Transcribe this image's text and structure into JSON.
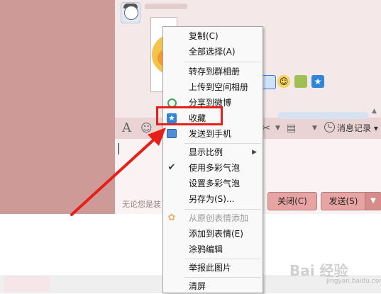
{
  "menu": {
    "items": [
      {
        "label": "复制(C)",
        "enabled": true
      },
      {
        "label": "全部选择(A)",
        "enabled": true
      },
      {
        "label": "转存到群相册",
        "enabled": true
      },
      {
        "label": "上传到空间相册",
        "enabled": true
      },
      {
        "label": "分享到微博",
        "enabled": true,
        "icon": "weibo-icon"
      },
      {
        "label": "收藏",
        "enabled": true,
        "icon": "star-icon",
        "highlighted": true
      },
      {
        "label": "发送到手机",
        "enabled": true,
        "icon": "phone-icon"
      },
      {
        "label": "显示比例",
        "enabled": true,
        "submenu": true
      },
      {
        "label": "使用多彩气泡",
        "enabled": true,
        "checked": true
      },
      {
        "label": "设置多彩气泡",
        "enabled": true
      },
      {
        "label": "另存为(S)...",
        "enabled": true
      },
      {
        "label": "从原创表情添加",
        "enabled": false,
        "icon": "add-emoji-icon"
      },
      {
        "label": "添加到表情(E)",
        "enabled": true
      },
      {
        "label": "涂鸦编辑",
        "enabled": true
      },
      {
        "label": "举报此图片",
        "enabled": true
      },
      {
        "label": "清屏",
        "enabled": true
      }
    ]
  },
  "chat": {
    "input_hint": "无论您是装",
    "history_label": "消息记录",
    "close_label": "关闭(C)",
    "send_label": "发送(S)"
  },
  "colors": {
    "highlight": "#e62018",
    "left_panel": "#cd9a98",
    "button": "#e8a4a2"
  },
  "watermark": {
    "text": "Bai 经验",
    "sub": "jingyan.baidu.com"
  }
}
